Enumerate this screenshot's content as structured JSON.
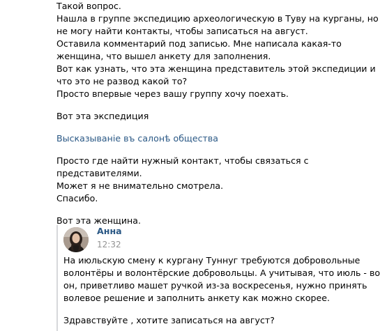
{
  "post": {
    "lines": [
      "Такой вопрос.",
      "Нашла в группе экспедицию археологическую в Туву на курганы, но",
      "не могу найти контакты, чтобы записаться на август.",
      "Оставила комментарий под записью. Мне написала какая-то",
      "женщина, что вышел анкету для заполнения.",
      "Вот как узнать, что эта женщина представитель этой экспедиции и",
      "что это не развод какой то?",
      "Просто впервые через вашу группу хочу поехать."
    ],
    "line_expedition": "Вот эта экспедиция",
    "group_link": "Высказываніе въ салонѣ общества",
    "lines2": [
      "Просто где найти нужный контакт, чтобы связаться с",
      "представителями.",
      "Может я не внимательно смотрела.",
      "Спасибо."
    ],
    "line_woman": "Вот эта женщина."
  },
  "quoted": {
    "author": "Анна",
    "time": "12:32",
    "text_lines": [
      "На июльскую смену к кургану Туннуг требуются добровольные",
      "волонтёры и волонтёрские добровольцы. А учитывая, что июль - вот",
      "он, приветливо машет ручкой из-за воскресенья, нужно принять",
      "волевое решение и заполнить анкету как можно скорее."
    ],
    "text_last": "Здравствуйте , хотите записаться на август?"
  },
  "colors": {
    "link": "#2a5885",
    "muted": "#939393",
    "quote_bar": "#d7d8db"
  }
}
